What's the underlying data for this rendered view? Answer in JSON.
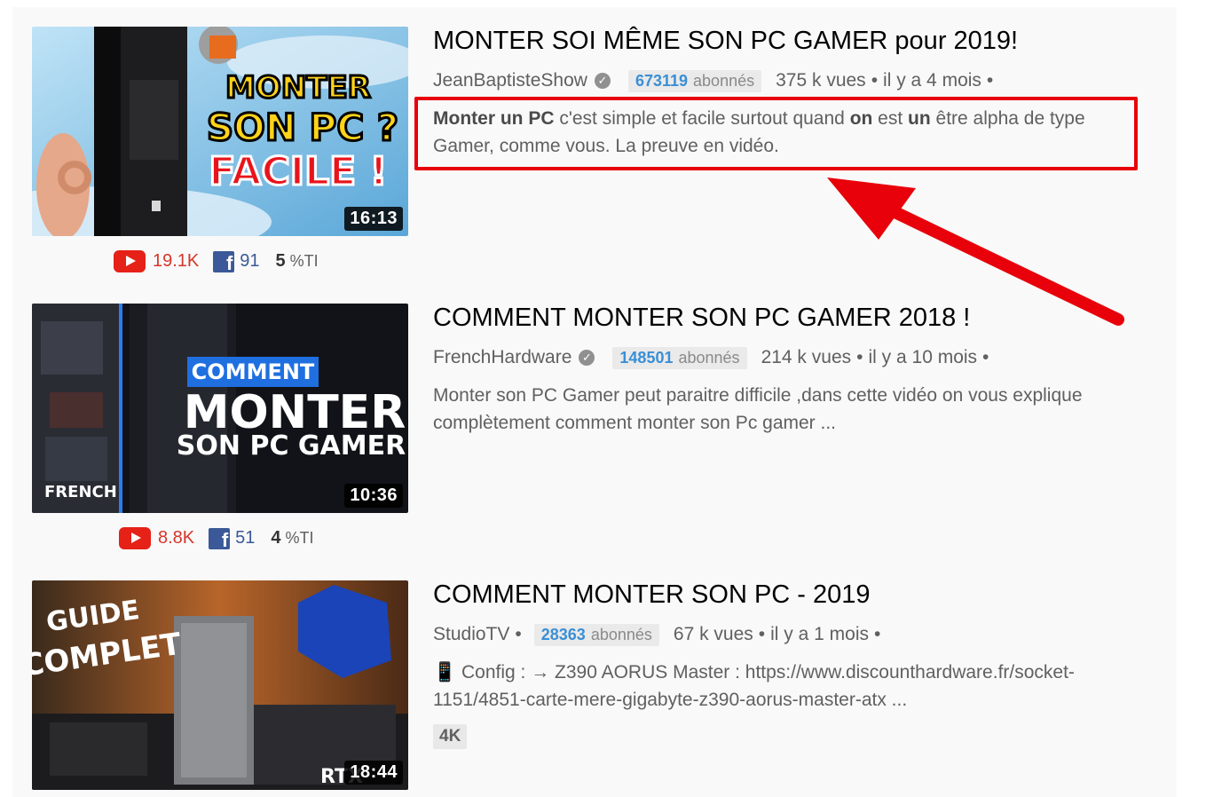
{
  "colors": {
    "subscriber_number": "#3a8fd6",
    "youtube_red": "#e62117",
    "facebook_blue": "#3b5998",
    "annotation_red": "#e8000a"
  },
  "stats_labels": {
    "ti_suffix": "%TI"
  },
  "videos": [
    {
      "title": "MONTER SOI MÊME SON PC GAMER pour 2019!",
      "channel": "JeanBaptisteShow",
      "verified": true,
      "subscribers": "673119",
      "subscribers_label": "abonnés",
      "views": "375 k vues",
      "age": "il y a 4 mois",
      "description_parts": [
        {
          "text": "Monter un PC",
          "bold": true
        },
        {
          "text": " c'est simple et facile surtout quand ",
          "bold": false
        },
        {
          "text": "on",
          "bold": true
        },
        {
          "text": " est ",
          "bold": false
        },
        {
          "text": "un",
          "bold": true
        },
        {
          "text": " être alpha de type Gamer, comme vous. La preuve en vidéo.",
          "bold": false
        }
      ],
      "duration": "16:13",
      "thumb_text": [
        "MONTER",
        "SON PC ?",
        "FACILE !"
      ],
      "youtube_likes": "19.1K",
      "facebook_shares": "91",
      "ti_value": "5"
    },
    {
      "title": "COMMENT MONTER SON PC GAMER 2018 !",
      "channel": "FrenchHardware",
      "verified": true,
      "subscribers": "148501",
      "subscribers_label": "abonnés",
      "views": "214 k vues",
      "age": "il y a 10 mois",
      "description": "Monter son PC Gamer peut paraitre difficile ,dans cette vidéo on vous explique complètement comment monter son Pc gamer ...",
      "duration": "10:36",
      "thumb_text": [
        "COMMENT",
        "MONTER",
        "SON PC GAMER",
        "FRENCH"
      ],
      "youtube_likes": "8.8K",
      "facebook_shares": "51",
      "ti_value": "4"
    },
    {
      "title": "COMMENT MONTER SON PC - 2019",
      "channel": "StudioTV",
      "verified": false,
      "subscribers": "28363",
      "subscribers_label": "abonnés",
      "views": "67 k vues",
      "age": "il y a 1 mois",
      "description": "📱 Config : → Z390 AORUS Master : https://www.discounthardware.fr/socket-1151/4851-carte-mere-gigabyte-z390-aorus-master-atx ...",
      "badge": "4K",
      "duration": "18:44",
      "thumb_text": [
        "GUIDE",
        "COMPLET",
        "RTX"
      ]
    }
  ]
}
